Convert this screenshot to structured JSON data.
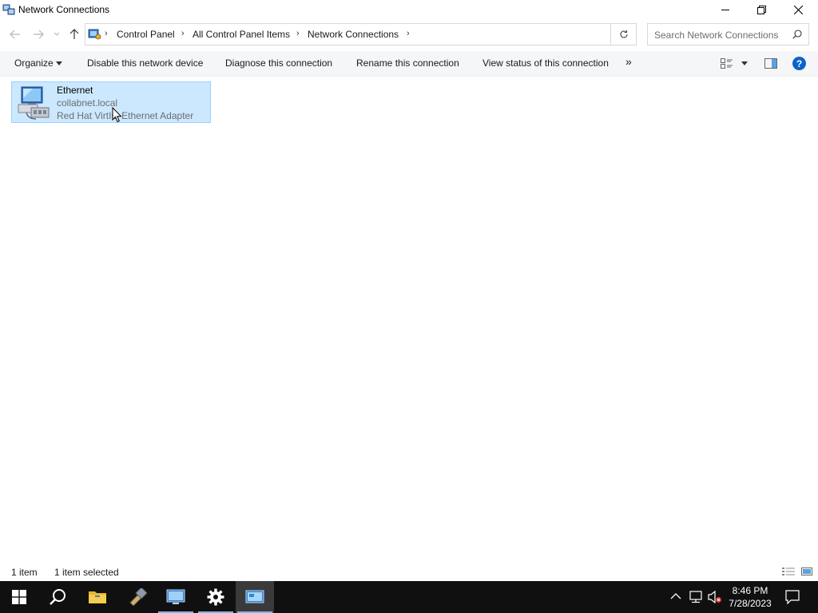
{
  "window": {
    "title": "Network Connections",
    "icon": "network-connections-icon"
  },
  "address": {
    "crumbs": [
      "Control Panel",
      "All Control Panel Items",
      "Network Connections"
    ],
    "search_placeholder": "Search Network Connections"
  },
  "toolbar": {
    "organize": "Organize",
    "disable": "Disable this network device",
    "diagnose": "Diagnose this connection",
    "rename": "Rename this connection",
    "view_status": "View status of this connection",
    "more": "»"
  },
  "connections": [
    {
      "name": "Ethernet",
      "network": "collabnet.local",
      "adapter": "Red Hat VirtIO Ethernet Adapter",
      "selected": true
    }
  ],
  "status": {
    "count": "1 item",
    "selected": "1 item selected"
  },
  "taskbar": {
    "time": "8:46 PM",
    "date": "7/28/2023"
  },
  "colors": {
    "selection_bg": "#cce8ff",
    "selection_border": "#99d1ff",
    "taskbar_bg": "#101010",
    "help_blue": "#0a64c8"
  }
}
